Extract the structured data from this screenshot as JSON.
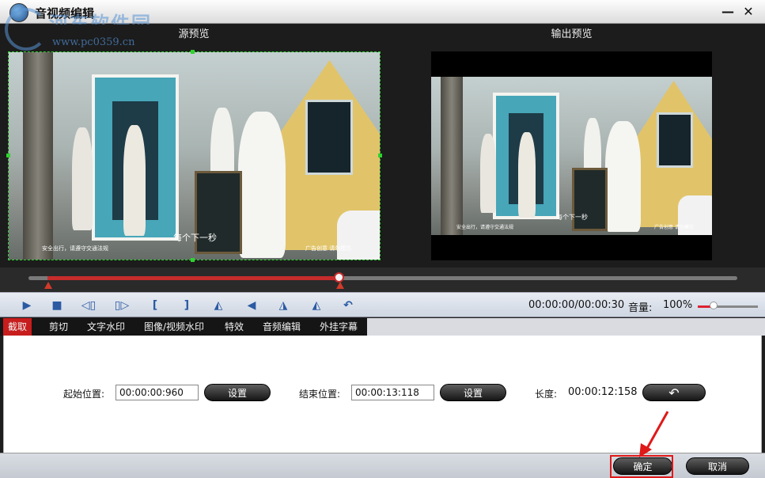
{
  "window": {
    "title": "音视频编辑",
    "minimize_glyph": "—",
    "close_glyph": "✕"
  },
  "watermark": {
    "site_name": "河东软件园",
    "url": "www.pc0359.cn"
  },
  "preview": {
    "source_label": "源预览",
    "output_label": "输出预览",
    "source_subtitle": "每个下一秒",
    "source_caption_left": "安全出行，请遵守交通法规",
    "source_caption_right": "广告创意 请勿模仿",
    "output_subtitle": "每个下一秒",
    "output_caption_left": "安全出行，请遵守交通法规",
    "output_caption_right": "广告创意 请勿模仿"
  },
  "timeline": {
    "range_start_fraction": 0.0,
    "range_end_fraction": 0.36,
    "playhead_fraction": 0.36
  },
  "toolbar": {
    "tools": [
      {
        "name": "play-icon",
        "glyph": "▶"
      },
      {
        "name": "stop-icon",
        "glyph": "■"
      },
      {
        "name": "prev-frame-icon",
        "glyph": "◁▯"
      },
      {
        "name": "next-frame-icon",
        "glyph": "▯▷"
      },
      {
        "name": "set-start-icon",
        "glyph": "["
      },
      {
        "name": "set-end-icon",
        "glyph": "]"
      },
      {
        "name": "flip-vertical-icon",
        "glyph": "◭"
      },
      {
        "name": "flip-horizontal-icon",
        "glyph": "◀"
      },
      {
        "name": "rotate-left-icon",
        "glyph": "◮"
      },
      {
        "name": "rotate-right-icon",
        "glyph": "◭"
      },
      {
        "name": "undo-icon",
        "glyph": "↶"
      }
    ],
    "time": "00:00:00/00:00:30",
    "volume_label": "音量:",
    "volume_value": "100%",
    "volume_fraction": 0.25
  },
  "tabs": [
    {
      "label": "截取",
      "active": true
    },
    {
      "label": "剪切",
      "active": false
    },
    {
      "label": "文字水印",
      "active": false
    },
    {
      "label": "图像/视频水印",
      "active": false
    },
    {
      "label": "特效",
      "active": false
    },
    {
      "label": "音频编辑",
      "active": false
    },
    {
      "label": "外挂字幕",
      "active": false
    }
  ],
  "trim": {
    "start_label": "起始位置:",
    "start_value": "00:00:00:960",
    "start_set": "设置",
    "end_label": "结束位置:",
    "end_value": "00:00:13:118",
    "end_set": "设置",
    "length_label": "长度:",
    "length_value": "00:00:12:158",
    "reset_glyph": "↶"
  },
  "footer": {
    "ok": "确定",
    "cancel": "取消"
  },
  "colors": {
    "accent_red": "#c71d1d",
    "selection_green": "#2fd22f",
    "highlight_red": "#e01919"
  }
}
